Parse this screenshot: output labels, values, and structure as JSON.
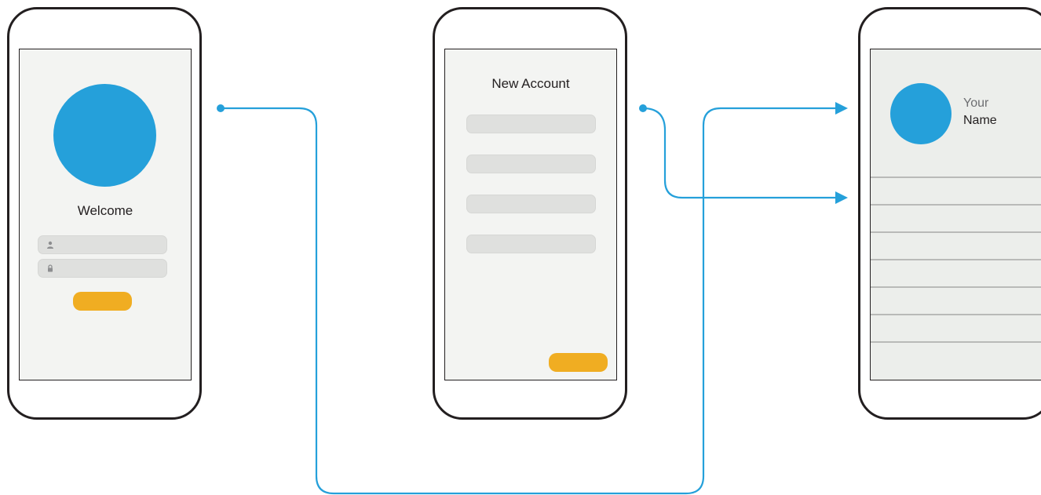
{
  "colors": {
    "accent_blue": "#25a0da",
    "button_orange": "#f0ad22",
    "outline": "#231f20",
    "screen_bg": "#f3f4f2",
    "field_bg": "#dfe0de",
    "divider": "#b9bab8"
  },
  "login_screen": {
    "title": "Welcome",
    "fields": [
      {
        "icon": "user-icon"
      },
      {
        "icon": "lock-icon"
      }
    ],
    "button": {
      "label": ""
    }
  },
  "signup_screen": {
    "title": "New Account",
    "field_count": 4,
    "button": {
      "label": ""
    }
  },
  "profile_screen": {
    "name_line1": "Your",
    "name_line2": "Name",
    "list_item_count": 7
  },
  "flows": [
    {
      "from": "login_screen",
      "to": "profile_screen"
    },
    {
      "from": "signup_screen",
      "to": "profile_screen"
    }
  ]
}
